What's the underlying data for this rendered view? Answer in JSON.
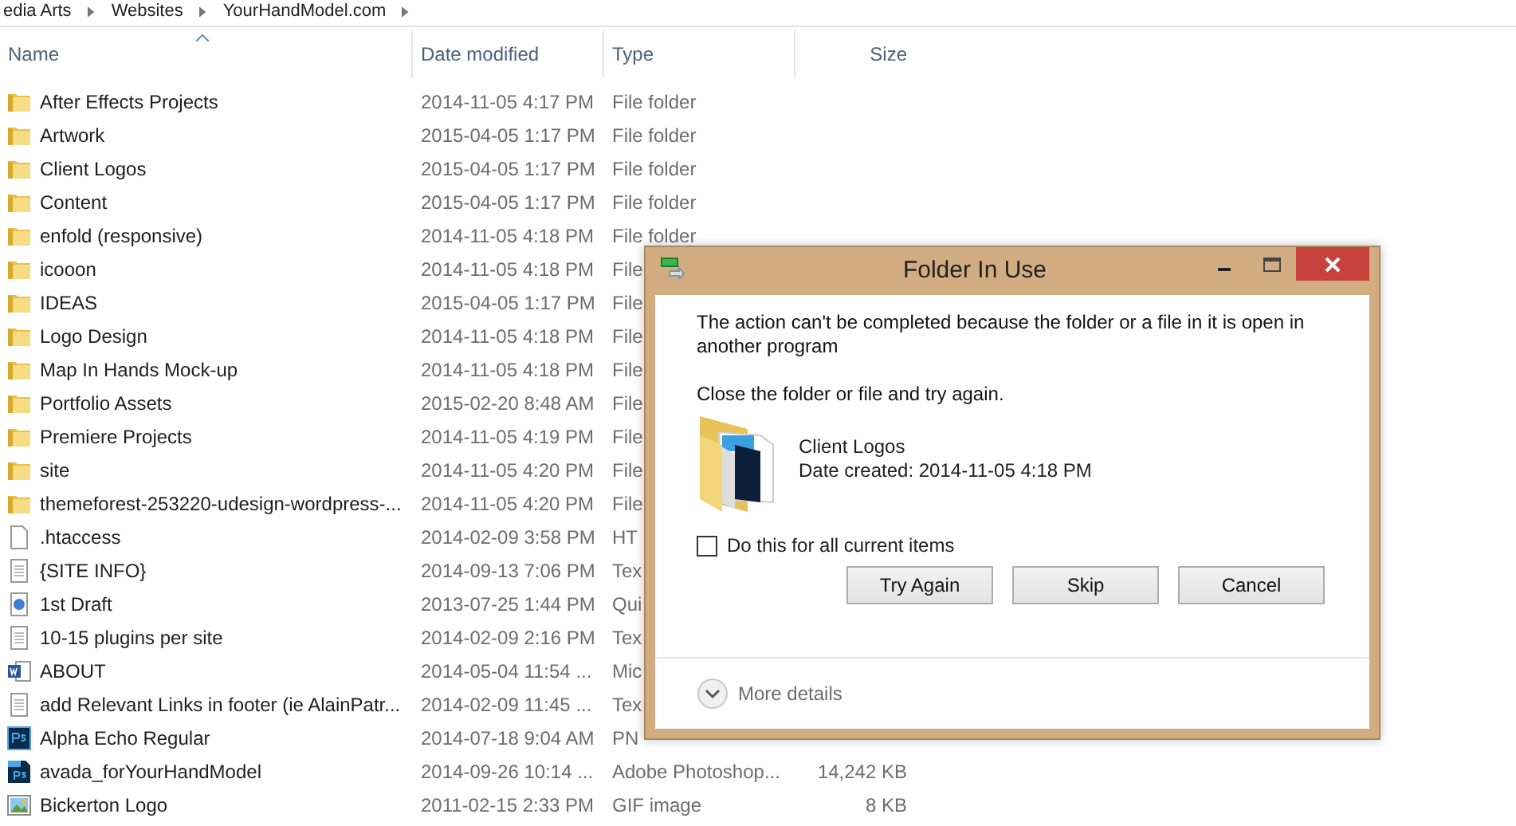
{
  "breadcrumb": [
    "edia Arts",
    "Websites",
    "YourHandModel.com"
  ],
  "table": {
    "columns": [
      {
        "label": "Name",
        "sorted": true
      },
      {
        "label": "Date modified",
        "sorted": false
      },
      {
        "label": "Type",
        "sorted": false
      },
      {
        "label": "Size",
        "sorted": false
      }
    ],
    "rows": [
      {
        "kind": "folder",
        "name": "After Effects Projects",
        "date": "2014-11-05 4:17 PM",
        "type": "File folder",
        "size": ""
      },
      {
        "kind": "folder",
        "name": "Artwork",
        "date": "2015-04-05 1:17 PM",
        "type": "File folder",
        "size": ""
      },
      {
        "kind": "folder",
        "name": "Client Logos",
        "date": "2015-04-05 1:17 PM",
        "type": "File folder",
        "size": ""
      },
      {
        "kind": "folder",
        "name": "Content",
        "date": "2015-04-05 1:17 PM",
        "type": "File folder",
        "size": ""
      },
      {
        "kind": "folder",
        "name": "enfold (responsive)",
        "date": "2014-11-05 4:18 PM",
        "type": "File folder",
        "size": ""
      },
      {
        "kind": "folder",
        "name": "icooon",
        "date": "2014-11-05 4:18 PM",
        "type": "File",
        "size": ""
      },
      {
        "kind": "folder",
        "name": "IDEAS",
        "date": "2015-04-05 1:17 PM",
        "type": "File",
        "size": ""
      },
      {
        "kind": "folder",
        "name": "Logo Design",
        "date": "2014-11-05 4:18 PM",
        "type": "File",
        "size": ""
      },
      {
        "kind": "folder",
        "name": "Map In Hands Mock-up",
        "date": "2014-11-05 4:18 PM",
        "type": "File",
        "size": ""
      },
      {
        "kind": "folder",
        "name": "Portfolio Assets",
        "date": "2015-02-20 8:48 AM",
        "type": "File",
        "size": ""
      },
      {
        "kind": "folder",
        "name": "Premiere Projects",
        "date": "2014-11-05 4:19 PM",
        "type": "File",
        "size": ""
      },
      {
        "kind": "folder",
        "name": "site",
        "date": "2014-11-05 4:20 PM",
        "type": "File",
        "size": ""
      },
      {
        "kind": "folder",
        "name": "themeforest-253220-udesign-wordpress-...",
        "date": "2014-11-05 4:20 PM",
        "type": "File",
        "size": ""
      },
      {
        "kind": "blank",
        "name": ".htaccess",
        "date": "2014-02-09 3:58 PM",
        "type": "HT",
        "size": ""
      },
      {
        "kind": "text",
        "name": "{SITE INFO}",
        "date": "2014-09-13 7:06 PM",
        "type": "Tex",
        "size": ""
      },
      {
        "kind": "movie",
        "name": "1st Draft",
        "date": "2013-07-25 1:44 PM",
        "type": "Qui",
        "size": ""
      },
      {
        "kind": "text",
        "name": "10-15 plugins per site",
        "date": "2014-02-09 2:16 PM",
        "type": "Tex",
        "size": ""
      },
      {
        "kind": "word",
        "name": "ABOUT",
        "date": "2014-05-04 11:54 ...",
        "type": "Mic",
        "size": ""
      },
      {
        "kind": "text",
        "name": "add Relevant Links in footer (ie AlainPatr...",
        "date": "2014-02-09 11:45 ...",
        "type": "Tex",
        "size": ""
      },
      {
        "kind": "ps",
        "name": "Alpha Echo Regular",
        "date": "2014-07-18 9:04 AM",
        "type": "PN",
        "size": ""
      },
      {
        "kind": "psd",
        "name": "avada_forYourHandModel",
        "date": "2014-09-26 10:14 ...",
        "type": "Adobe Photoshop...",
        "size": "14,242 KB"
      },
      {
        "kind": "image",
        "name": "Bickerton Logo",
        "date": "2011-02-15 2:33 PM",
        "type": "GIF image",
        "size": "8 KB"
      }
    ]
  },
  "dialog": {
    "title": "Folder In Use",
    "message": "The action can't be completed because the folder or a file in it is open in another program",
    "hint": "Close the folder or file and try again.",
    "item_name": "Client Logos",
    "item_date": "Date created: 2014-11-05 4:18 PM",
    "checkbox": {
      "label": "Do this for all current items",
      "checked": false
    },
    "buttons": [
      "Try Again",
      "Skip",
      "Cancel"
    ],
    "details": {
      "label": "More details",
      "expanded": false
    }
  }
}
